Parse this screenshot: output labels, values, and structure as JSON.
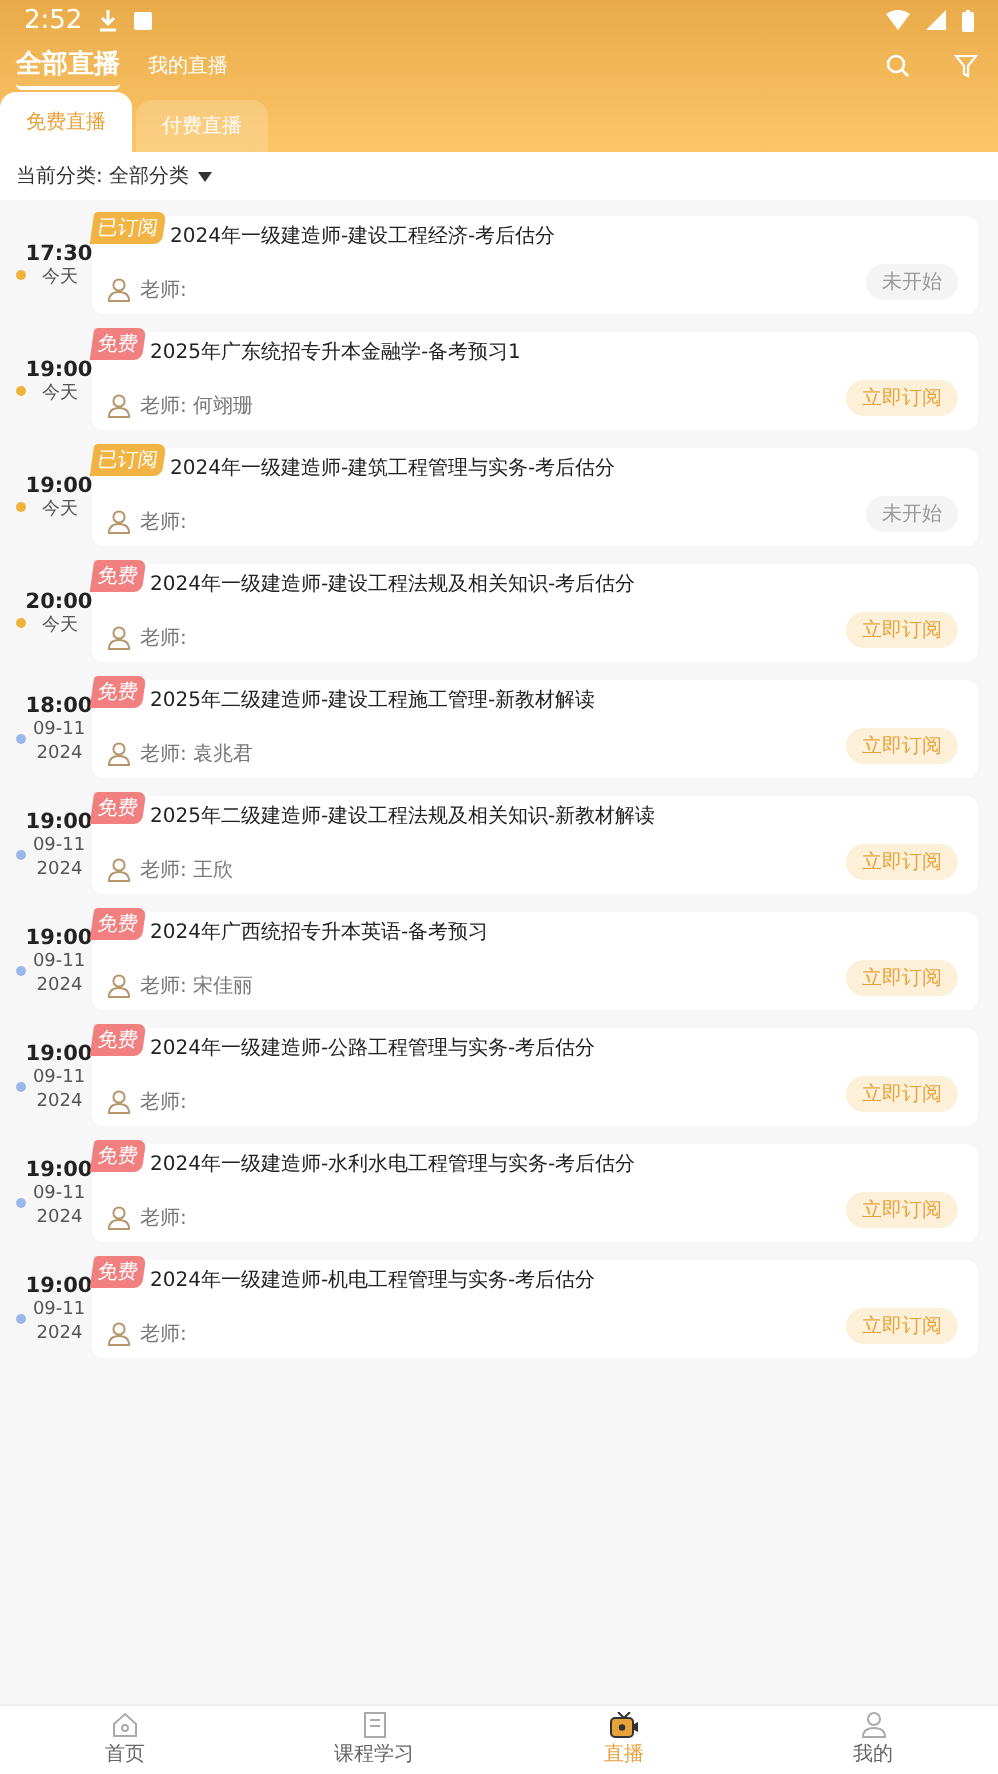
{
  "status_bar": {
    "time": "2:52"
  },
  "top_tabs": [
    {
      "label": "全部直播",
      "selected": true
    },
    {
      "label": "我的直播",
      "selected": false
    }
  ],
  "sub_tabs": [
    {
      "label": "免费直播",
      "selected": true
    },
    {
      "label": "付费直播",
      "selected": false
    }
  ],
  "filter": {
    "label": "当前分类:",
    "value": "全部分类"
  },
  "sessions": [
    {
      "time": "17:30",
      "day": "今天",
      "color": "#f0b43c",
      "badge": {
        "kind": "subscribed",
        "text": "已订阅"
      },
      "title": "2024年一级建造师-建设工程经济-考后估分",
      "teacher_label": "老师:",
      "action": {
        "kind": "not_started",
        "text": "未开始"
      }
    },
    {
      "time": "19:00",
      "day": "今天",
      "color": "#f0b43c",
      "badge": {
        "kind": "free",
        "text": "免费"
      },
      "title": "2025年广东统招专升本金融学-备考预习1",
      "teacher_label": "老师:",
      "teacher": "何翊珊",
      "action": {
        "kind": "subscribe",
        "text": "立即订阅"
      }
    },
    {
      "time": "19:00",
      "day": "今天",
      "color": "#f0b43c",
      "badge": {
        "kind": "subscribed",
        "text": "已订阅"
      },
      "title": "2024年一级建造师-建筑工程管理与实务-考后估分",
      "teacher_label": "老师:",
      "action": {
        "kind": "not_started",
        "text": "未开始"
      }
    },
    {
      "time": "20:00",
      "day": "今天",
      "color": "#f0b43c",
      "badge": {
        "kind": "free",
        "text": "免费"
      },
      "title": "2024年一级建造师-建设工程法规及相关知识-考后估分",
      "teacher_label": "老师:",
      "action": {
        "kind": "subscribe",
        "text": "立即订阅"
      }
    },
    {
      "time": "18:00",
      "day": "09-11",
      "year": "2024",
      "color": "#9db8e8",
      "badge": {
        "kind": "free",
        "text": "免费"
      },
      "title": "2025年二级建造师-建设工程施工管理-新教材解读",
      "teacher_label": "老师:",
      "teacher": "袁兆君",
      "action": {
        "kind": "subscribe",
        "text": "立即订阅"
      }
    },
    {
      "time": "19:00",
      "day": "09-11",
      "year": "2024",
      "color": "#9db8e8",
      "badge": {
        "kind": "free",
        "text": "免费"
      },
      "title": "2025年二级建造师-建设工程法规及相关知识-新教材解读",
      "teacher_label": "老师:",
      "teacher": "王欣",
      "action": {
        "kind": "subscribe",
        "text": "立即订阅"
      }
    },
    {
      "time": "19:00",
      "day": "09-11",
      "year": "2024",
      "color": "#9db8e8",
      "badge": {
        "kind": "free",
        "text": "免费"
      },
      "title": "2024年广西统招专升本英语-备考预习",
      "teacher_label": "老师:",
      "teacher": "宋佳丽",
      "action": {
        "kind": "subscribe",
        "text": "立即订阅"
      }
    },
    {
      "time": "19:00",
      "day": "09-11",
      "year": "2024",
      "color": "#9db8e8",
      "badge": {
        "kind": "free",
        "text": "免费"
      },
      "title": "2024年一级建造师-公路工程管理与实务-考后估分",
      "teacher_label": "老师:",
      "action": {
        "kind": "subscribe",
        "text": "立即订阅"
      }
    },
    {
      "time": "19:00",
      "day": "09-11",
      "year": "2024",
      "color": "#9db8e8",
      "badge": {
        "kind": "free",
        "text": "免费"
      },
      "title": "2024年一级建造师-水利水电工程管理与实务-考后估分",
      "teacher_label": "老师:",
      "action": {
        "kind": "subscribe",
        "text": "立即订阅"
      }
    },
    {
      "time": "19:00",
      "day": "09-11",
      "year": "2024",
      "color": "#9db8e8",
      "badge": {
        "kind": "free",
        "text": "免费"
      },
      "title": "2024年一级建造师-机电工程管理与实务-考后估分",
      "teacher_label": "老师:",
      "action": {
        "kind": "subscribe",
        "text": "立即订阅"
      }
    }
  ],
  "bottom_nav": [
    {
      "label": "首页",
      "selected": false
    },
    {
      "label": "课程学习",
      "selected": false
    },
    {
      "label": "直播",
      "selected": true
    },
    {
      "label": "我的",
      "selected": false
    }
  ]
}
